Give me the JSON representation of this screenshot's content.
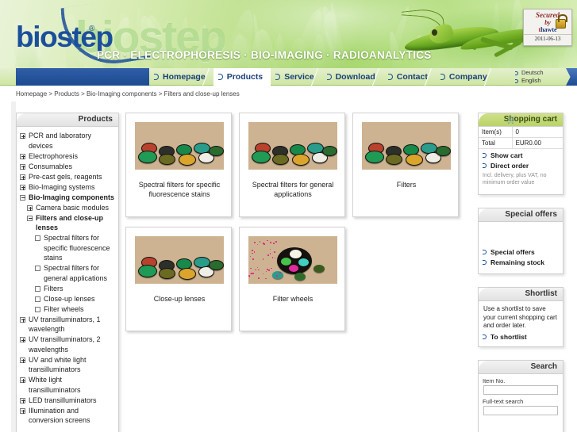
{
  "header": {
    "logo": "biostep",
    "logo_registered": "®",
    "tagline": "PCR · ELECTROPHORESIS · BIO-IMAGING  · RADIOANALYTICS",
    "ghost_logo": "biostep",
    "seal": {
      "line1": "Secured",
      "line2": "by",
      "brand_mark": "t",
      "brand": "hawte",
      "date": "2011-06-13"
    }
  },
  "nav": {
    "items": [
      {
        "label": "Homepage",
        "active": false
      },
      {
        "label": "Products",
        "active": true
      },
      {
        "label": "Service",
        "active": false
      },
      {
        "label": "Download",
        "active": false
      },
      {
        "label": "Contact",
        "active": false
      },
      {
        "label": "Company",
        "active": false
      }
    ],
    "languages": [
      "Deutsch",
      "English"
    ]
  },
  "breadcrumb": {
    "items": [
      "Homepage",
      "Products",
      "Bio-Imaging components",
      "Filters and close-up lenses"
    ],
    "separator": " > "
  },
  "sidebar": {
    "title": "Products",
    "items": [
      {
        "label": "PCR and laboratory devices",
        "level": 1,
        "state": "plus",
        "bold": false
      },
      {
        "label": "Electrophoresis",
        "level": 1,
        "state": "plus",
        "bold": false
      },
      {
        "label": "Consumables",
        "level": 1,
        "state": "plus",
        "bold": false
      },
      {
        "label": "Pre-cast gels, reagents",
        "level": 1,
        "state": "plus",
        "bold": false
      },
      {
        "label": "Bio-Imaging systems",
        "level": 1,
        "state": "plus",
        "bold": false
      },
      {
        "label": "Bio-Imaging components",
        "level": 1,
        "state": "minus",
        "bold": true
      },
      {
        "label": "Camera basic modules",
        "level": 2,
        "state": "plus",
        "bold": false
      },
      {
        "label": "Filters and close-up lenses",
        "level": 2,
        "state": "minus",
        "bold": true
      },
      {
        "label": "Spectral filters for specific fluorescence stains",
        "level": 3,
        "state": "leaf",
        "bold": false
      },
      {
        "label": "Spectral filters for general applications",
        "level": 3,
        "state": "leaf",
        "bold": false
      },
      {
        "label": "Filters",
        "level": 3,
        "state": "leaf",
        "bold": false
      },
      {
        "label": "Close-up lenses",
        "level": 3,
        "state": "leaf",
        "bold": false
      },
      {
        "label": "Filter wheels",
        "level": 3,
        "state": "leaf",
        "bold": false
      },
      {
        "label": "UV transilluminators, 1 wavelength",
        "level": 1,
        "state": "plus",
        "bold": false
      },
      {
        "label": "UV transilluminators, 2 wavelengths",
        "level": 1,
        "state": "plus",
        "bold": false
      },
      {
        "label": "UV and white light transilluminators",
        "level": 1,
        "state": "plus",
        "bold": false
      },
      {
        "label": "White light transilluminators",
        "level": 1,
        "state": "plus",
        "bold": false
      },
      {
        "label": "LED transilluminators",
        "level": 1,
        "state": "plus",
        "bold": false
      },
      {
        "label": "Illumination and conversion screens",
        "level": 1,
        "state": "plus",
        "bold": false
      }
    ]
  },
  "products": [
    {
      "caption": "Spectral filters for specific fluorescence stains",
      "image": "filter-discs-photo"
    },
    {
      "caption": "Spectral filters for general applications",
      "image": "filter-discs-photo"
    },
    {
      "caption": "Filters",
      "image": "filter-discs-photo"
    },
    {
      "caption": "Close-up lenses",
      "image": "filter-discs-photo"
    },
    {
      "caption": "Filter wheels",
      "image": "filter-wheel-photo"
    }
  ],
  "cart": {
    "title": "Shopping cart",
    "icon": "cart-icon",
    "rows": [
      {
        "key": "Item(s)",
        "value": "0"
      },
      {
        "key": "Total",
        "value": "EUR0.00"
      }
    ],
    "links": [
      "Show cart",
      "Direct order"
    ],
    "note": "Incl. delivery, plus VAT, no minimum order value"
  },
  "offers": {
    "title": "Special offers",
    "links": [
      "Special offers",
      "Remaining stock"
    ]
  },
  "shortlist": {
    "title": "Shortlist",
    "text": "Use a shortlist to save your current shopping cart and order later.",
    "links": [
      "To shortlist"
    ]
  },
  "search": {
    "title": "Search",
    "fields": [
      {
        "label": "Item No.",
        "value": "",
        "placeholder": ""
      },
      {
        "label": "Full-text search",
        "value": "",
        "placeholder": ""
      }
    ]
  },
  "colors": {
    "brand_blue": "#1b4f9c",
    "nav_blue": "#1d4a90",
    "header_green": "#a9d870",
    "panel_green": "#c4da79"
  }
}
